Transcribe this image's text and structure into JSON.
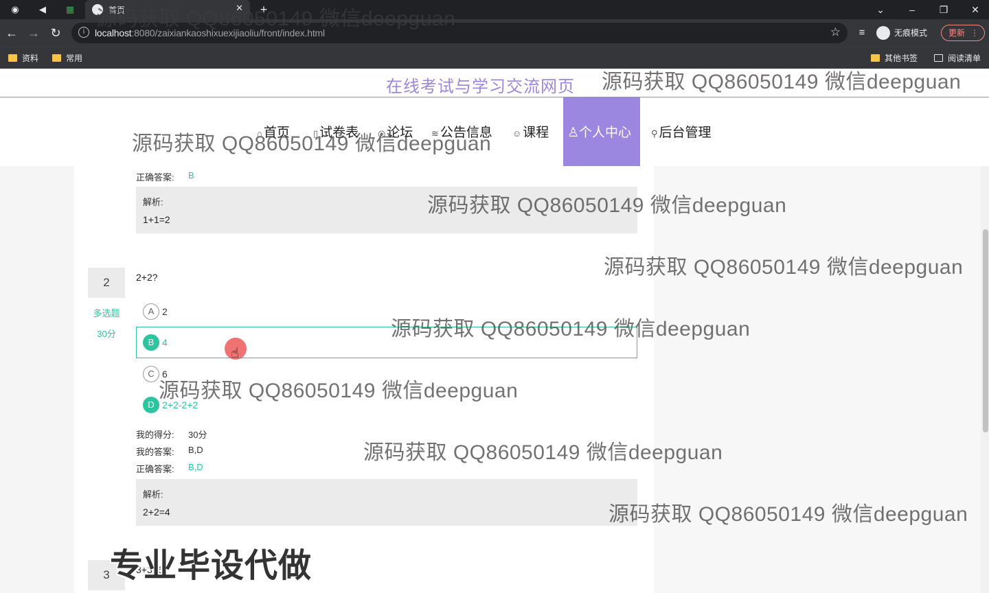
{
  "browser": {
    "tab_title": "首页",
    "url_host": "localhost",
    "url_rest": ":8080/zaixiankaoshixuexijiaoliu/front/index.html",
    "incognito_label": "无痕模式",
    "update_label": "更新",
    "bookmarks": [
      "资料",
      "常用"
    ],
    "bookmarks_right": [
      "其他书签",
      "阅读清单"
    ]
  },
  "site": {
    "title": "在线考试与学习交流网页",
    "nav": [
      {
        "icon": "home-icon",
        "label": "首页"
      },
      {
        "icon": "paper-icon",
        "label": "试卷表"
      },
      {
        "icon": "forum-icon",
        "label": "论坛"
      },
      {
        "icon": "notice-icon",
        "label": "公告信息"
      },
      {
        "icon": "course-icon",
        "label": "课程"
      },
      {
        "icon": "user-icon",
        "label": "个人中心"
      },
      {
        "icon": "link-icon",
        "label": "后台管理"
      }
    ],
    "active_nav": "个人中心"
  },
  "exam": {
    "q1": {
      "correct_label": "正确答案:",
      "correct_value": "B",
      "analysis_label": "解析:",
      "analysis_text": "1+1=2"
    },
    "q2": {
      "number": "2",
      "question": "2+2?",
      "type": "多选题",
      "score": "30分",
      "options": [
        {
          "letter": "A",
          "text": "2",
          "selected": false
        },
        {
          "letter": "B",
          "text": "4",
          "selected": true
        },
        {
          "letter": "C",
          "text": "6",
          "selected": false
        },
        {
          "letter": "D",
          "text": "2+2-2+2",
          "selected": true
        }
      ],
      "my_score_label": "我的得分:",
      "my_score_value": "30分",
      "my_answer_label": "我的答案:",
      "my_answer_value": "B,D",
      "correct_label": "正确答案:",
      "correct_value": "B,D",
      "analysis_label": "解析:",
      "analysis_text": "2+2=4"
    },
    "q3": {
      "number": "3",
      "question": "3+3=6?"
    }
  },
  "watermarks": {
    "text": "源码获取 QQ86050149 微信deepguan",
    "big": "专业毕设代做"
  },
  "colors": {
    "accent": "#9b87e0",
    "selected": "#2ec4a0"
  }
}
